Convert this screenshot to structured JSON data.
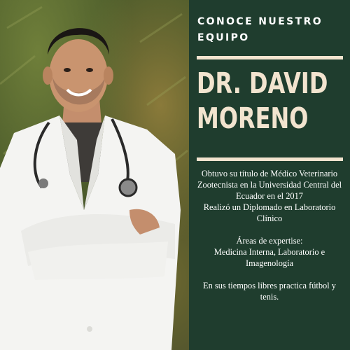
{
  "panel": {
    "kicker_line1": "CONOCE NUESTRO",
    "kicker_line2": "EQUIPO",
    "name_line1": "DR. DAVID",
    "name_line2": "MORENO",
    "bio_lines": [
      "Obtuvo su título de Médico Veterinario",
      "Zootecnista en la Universidad Central del",
      "Ecuador  en el 2017",
      "Realizó un Diplomado en Laboratorio",
      "Clínico"
    ],
    "expertise_lines": [
      "Áreas de expertise:",
      "Medicina Interna, Laboratorio e",
      "Imagenología"
    ],
    "hobby_lines": [
      "En sus tiempos libres practica fútbol y",
      "tenis."
    ]
  },
  "colors": {
    "panel_bg": "#1f3d2e",
    "accent_cream": "#f2e4cf",
    "coat_white": "#f4f4f2"
  }
}
